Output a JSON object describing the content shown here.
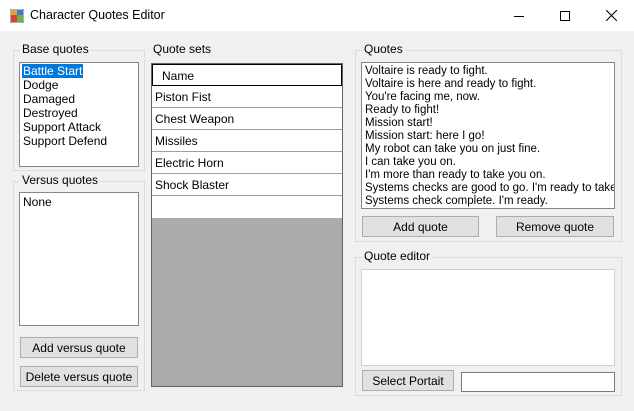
{
  "window": {
    "title": "Character Quotes Editor"
  },
  "base_quotes": {
    "label": "Base quotes",
    "items": [
      "Battle Start",
      "Dodge",
      "Damaged",
      "Destroyed",
      "Support Attack",
      "Support Defend"
    ],
    "selected_index": 0
  },
  "versus_quotes": {
    "label": "Versus quotes",
    "items": [
      "None"
    ],
    "add_label": "Add versus quote",
    "delete_label": "Delete versus quote"
  },
  "quote_sets": {
    "label": "Quote sets",
    "header": "Name",
    "rows": [
      "Piston Fist",
      "Chest Weapon",
      "Missiles",
      "Electric Horn",
      "Shock Blaster"
    ]
  },
  "quotes": {
    "label": "Quotes",
    "items": [
      "Voltaire is ready to fight.",
      "Voltaire is here and ready to fight.",
      "You're facing me, now.",
      "Ready to fight!",
      "Mission start!",
      "Mission start: here I go!",
      "My robot can take you on just fine.",
      "I can take you on.",
      "I'm more than ready to take you on.",
      "Systems checks are good to go. I'm ready to take you on.",
      "Systems check complete. I'm ready."
    ],
    "add_label": "Add quote",
    "remove_label": "Remove quote"
  },
  "quote_editor": {
    "label": "Quote editor",
    "value": "",
    "select_portrait_label": "Select Portait",
    "portrait_value": ""
  },
  "colors": {
    "selection": "#0078d7",
    "button_face": "#e1e1e1",
    "grid_background": "#ababab"
  }
}
